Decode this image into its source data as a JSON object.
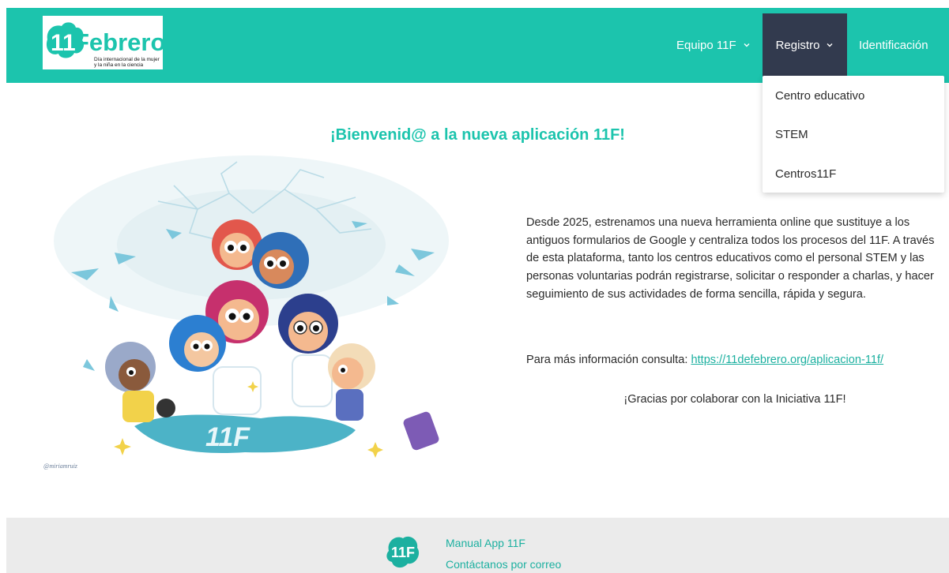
{
  "header": {
    "logo_text": "11Febrero",
    "logo_tagline_1": "Día internacional de la mujer",
    "logo_tagline_2": "y la niña en la ciencia",
    "nav": [
      {
        "label": "Equipo 11F"
      },
      {
        "label": "Registro"
      },
      {
        "label": "Identificación"
      }
    ],
    "registro_dropdown": [
      {
        "label": "Centro educativo"
      },
      {
        "label": "STEM"
      },
      {
        "label": "Centros11F"
      }
    ]
  },
  "main": {
    "title": "¡Bienvenid@ a la nueva aplicación 11F!",
    "intro": "Desde 2025, estrenamos una nueva herramienta online que sustituye a los antiguos formularios de Google y centraliza todos los procesos del 11F. A través de esta plataforma, tanto los centros educativos como el personal STEM y las personas voluntarias podrán registrarse, solicitar o responder a charlas, y hacer seguimiento de sus actividades de forma sencilla, rápida y segura.",
    "info_prefix": "Para más información consulta: ",
    "info_link": "https://11defebrero.org/aplicacion-11f/",
    "thanks": "¡Gracias por colaborar con la Iniciativa 11F!",
    "illustration_signature": "@miriamruiz",
    "illustration_label": "11F"
  },
  "footer": {
    "logo_text": "11F",
    "links": [
      {
        "label": "Manual App 11F"
      },
      {
        "label": "Contáctanos por correo"
      }
    ]
  },
  "colors": {
    "brand_teal": "#1cc4ad",
    "nav_active": "#323a4e",
    "footer_bg": "#ebebeb",
    "link": "#1cb0a0"
  },
  "icons": [
    "chevron-down-icon",
    "logo-mark-icon"
  ]
}
